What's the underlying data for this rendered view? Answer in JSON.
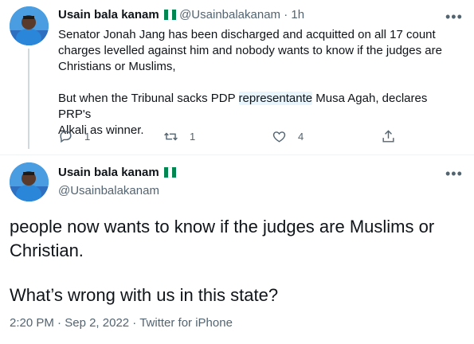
{
  "reply_tweet": {
    "author_name": "Usain bala kanam",
    "author_handle": "@Usainbalakanam",
    "separator": "·",
    "time_ago": "1h",
    "text_lines": [
      "Senator Jonah Jang has been discharged and acquitted on all 17 count",
      "charges levelled against him and nobody wants to know if the judges are",
      "Christians or Muslims,"
    ],
    "text2_before": "But when the Tribunal sacks PDP ",
    "text2_highlight": "representante",
    "text2_after": " Musa Agah, declares PRP's",
    "text2_line2": "Alkali as winner.",
    "replies": "1",
    "retweets": "1",
    "likes": "4"
  },
  "main_tweet": {
    "author_name": "Usain bala kanam",
    "author_handle": "@Usainbalakanam",
    "line1": "people now wants to know if the judges are Muslims or",
    "line2": "Christian.",
    "line3": "What’s wrong with us in this state?",
    "time": "2:20 PM",
    "date": "Sep 2, 2022",
    "source": "Twitter for iPhone",
    "separator": "·"
  },
  "colors": {
    "flag_green": "#008751",
    "highlight_bg": "#e8f5fd",
    "muted_text": "#536471"
  },
  "icons": [
    "reply-icon",
    "retweet-icon",
    "like-icon",
    "share-icon",
    "more-icon",
    "nigeria-flag-icon"
  ]
}
